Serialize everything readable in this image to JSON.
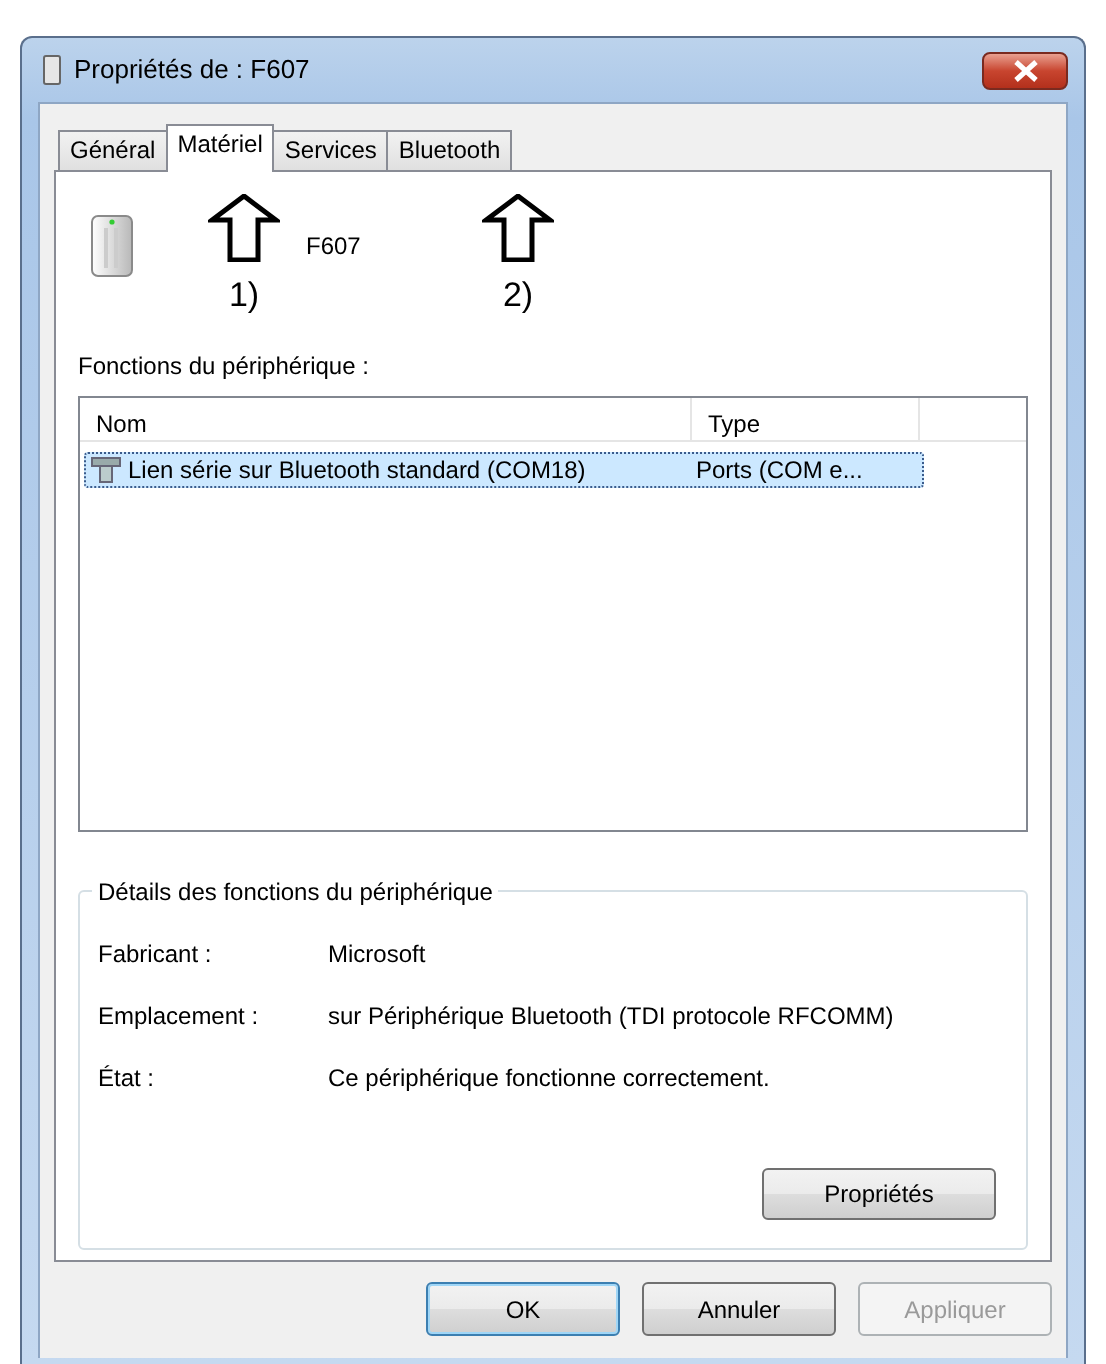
{
  "window": {
    "title": "Propriétés de : F607"
  },
  "tabs": [
    {
      "label": "Général",
      "selected": false
    },
    {
      "label": "Matériel",
      "selected": true
    },
    {
      "label": "Services",
      "selected": false
    },
    {
      "label": "Bluetooth",
      "selected": false
    }
  ],
  "device": {
    "name": "F607"
  },
  "functions": {
    "label": "Fonctions du périphérique :",
    "columns": [
      "Nom",
      "Type"
    ],
    "rows": [
      {
        "name": "Lien série sur Bluetooth standard (COM18)",
        "type": "Ports (COM e...",
        "selected": true
      }
    ]
  },
  "details": {
    "title": "Détails des fonctions du périphérique",
    "fields": [
      {
        "label": "Fabricant :",
        "value": "Microsoft"
      },
      {
        "label": "Emplacement :",
        "value": "sur Périphérique Bluetooth (TDI protocole RFCOMM)"
      },
      {
        "label": "État :",
        "value": "Ce périphérique fonctionne correctement."
      }
    ],
    "button": "Propriétés"
  },
  "buttons": [
    {
      "label": "OK",
      "default": true,
      "disabled": false
    },
    {
      "label": "Annuler",
      "default": false,
      "disabled": false
    },
    {
      "label": "Appliquer",
      "default": false,
      "disabled": true
    }
  ],
  "annotations": [
    {
      "label": "1)"
    },
    {
      "label": "2)"
    }
  ]
}
